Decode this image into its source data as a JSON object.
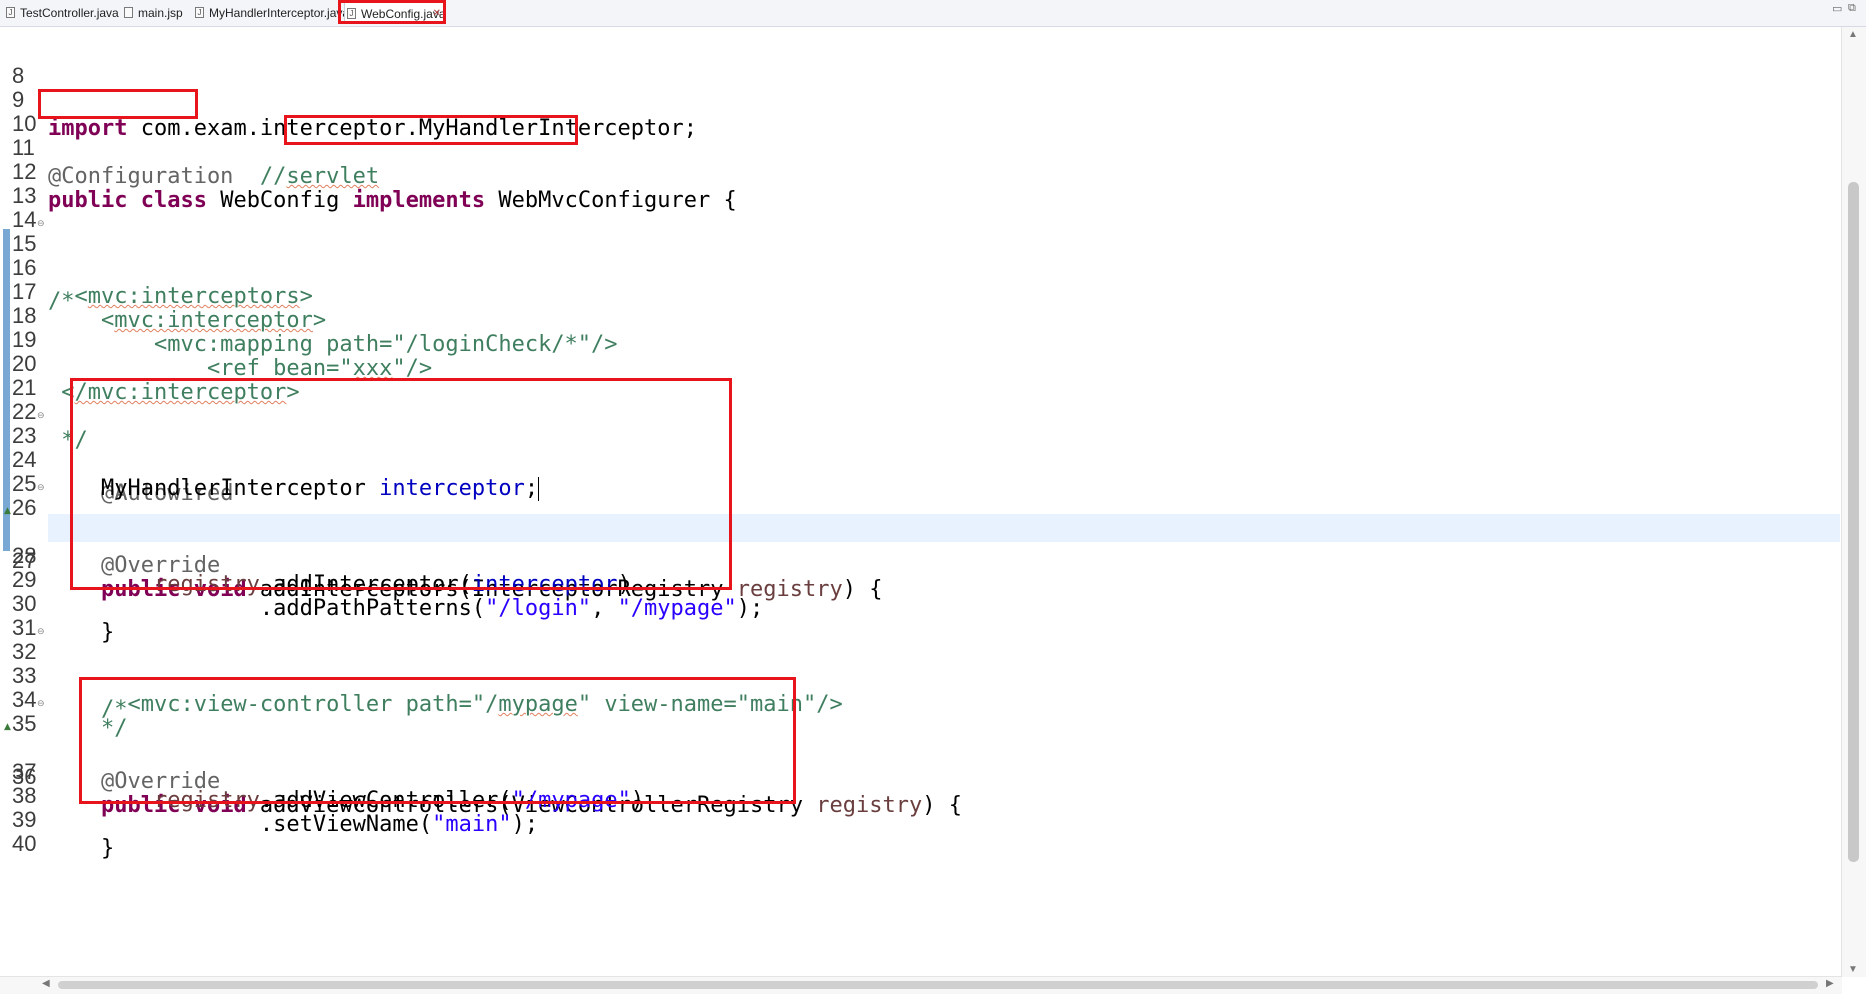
{
  "tabs": [
    {
      "label": "TestController.java",
      "icon": "java-file-icon"
    },
    {
      "label": "main.jsp",
      "icon": "jsp-file-icon"
    },
    {
      "label": "MyHandlerInterceptor.java",
      "icon": "java-file-icon"
    },
    {
      "label": "WebConfig.java",
      "icon": "java-file-icon",
      "active": true
    }
  ],
  "window_controls": {
    "minimize": "▭",
    "restore": "⧉"
  },
  "line_numbers": [
    "8",
    "9",
    "10",
    "11",
    "12",
    "13",
    "14",
    "15",
    "16",
    "17",
    "18",
    "19",
    "20",
    "21",
    "22",
    "23",
    "24",
    "25",
    "26",
    "27",
    "28",
    "29",
    "30",
    "31",
    "32",
    "33",
    "34",
    "35",
    "36",
    "37",
    "38",
    "39",
    "40"
  ],
  "code": {
    "l9_kw": "import",
    "l9_rest": " com.exam.interceptor.MyHandlerInterceptor;",
    "l11_ann": "@Configuration",
    "l11_cmt_prefix": "  //",
    "l11_cmt_word": "servlet",
    "l12_kw": "public class",
    "l12_name": " WebConfig ",
    "l12_impl": "implements",
    "l12_iface": " WebMvcConfigurer",
    "l12_brace": " {",
    "l15": "/*",
    "l16_tag": "mvc:interceptors",
    "l17_tag": "mvc:interceptor",
    "l18": "        <mvc:mapping path=\"/loginCheck/*\"/>",
    "l19_pre": "            <ref bean=\"",
    "l19_val": "xxx",
    "l19_post": "\"/>",
    "l20_tag": "/mvc:interceptor",
    "l22": " */",
    "l23_ann": "@Autowired",
    "l24_type": "MyHandlerInterceptor ",
    "l24_field": "interceptor",
    "l24_semi": ";",
    "l26_ann": "@Override",
    "l27_kw": "public void",
    "l27_sig": " addInterceptors(InterceptorRegistry ",
    "l27_param": "registry",
    "l27_end": ") {",
    "l28_param": "registry",
    "l28_call": ".addInterceptor(",
    "l28_field": "interceptor",
    "l28_end": ")",
    "l29_call": ".addPathPatterns(",
    "l29_s1": "\"/login\"",
    "l29_comma": ", ",
    "l29_s2": "\"/mypage\"",
    "l29_end": ");",
    "l30": "}",
    "l32": "/*",
    "l33_pre": "  <mvc:view-controller path=\"/",
    "l33_word": "mypage",
    "l33_post": "\" view-name=\"main\"/>",
    "l34": "*/",
    "l35_ann": "@Override",
    "l36_kw": "public void",
    "l36_sig": " addViewControllers(ViewControllerRegistry ",
    "l36_param": "registry",
    "l36_end": ") {",
    "l37_param": "registry",
    "l37_call": ".addViewController(",
    "l37_str": "\"/mypage\"",
    "l37_end": ")",
    "l38_call": ".setViewName(",
    "l38_str": "\"main\"",
    "l38_end": ");",
    "l39": "}"
  },
  "colors": {
    "keyword": "#7f0055",
    "annotation": "#646464",
    "comment": "#3f7f5f",
    "string": "#2a00ff",
    "field": "#0000c0",
    "highlight_box": "#e8141c",
    "current_line": "#e8f2fe"
  }
}
